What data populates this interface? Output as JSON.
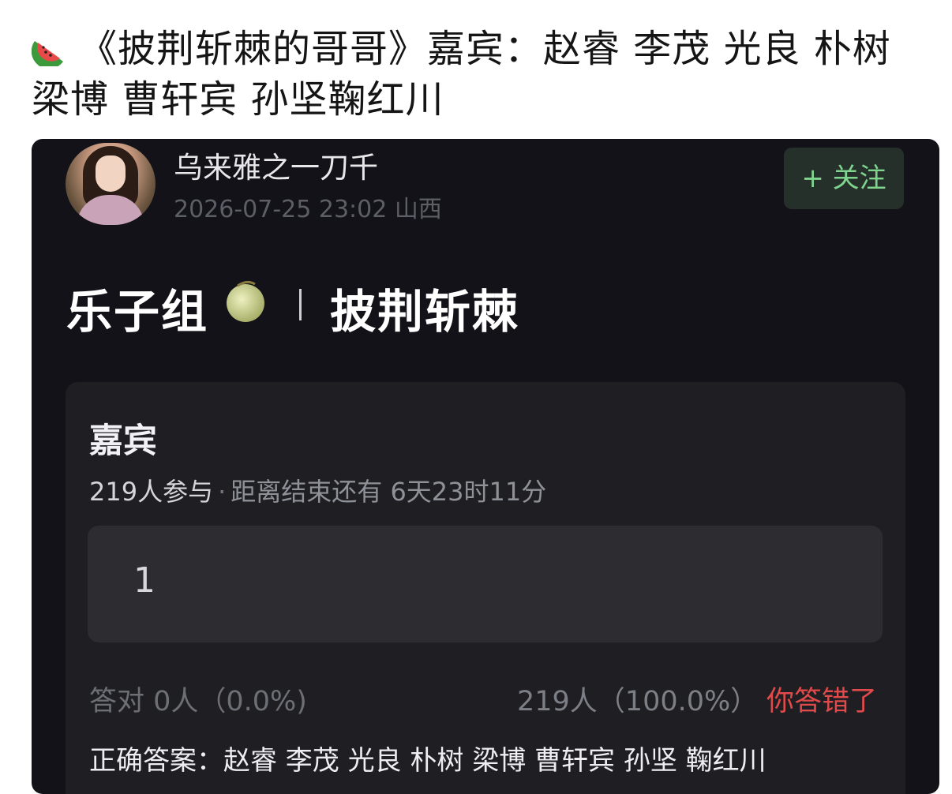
{
  "headline": {
    "emoji_icon": "watermelon-icon",
    "text": "《披荆斩棘的哥哥》嘉宾：赵睿 李茂 光良 朴树 梁博 曹轩宾 孙坚鞠红川"
  },
  "post": {
    "username": "乌来雅之一刀千",
    "timestamp": "2026-07-25 23:02",
    "location": "山西",
    "follow_label": "+ 关注"
  },
  "topic": {
    "group": "乐子组",
    "group_icon": "melon-icon",
    "name": "披荆斩棘"
  },
  "poll": {
    "title": "嘉宾",
    "participants": "219人参与",
    "separator": "·",
    "remaining": "距离结束还有 6天23时11分",
    "option_label": "1",
    "correct_stat": "答对  0人（0.0%)",
    "wrong_stat": "219人（100.0%）",
    "wrong_badge": "你答错了",
    "answer": "正确答案：赵睿 李茂 光良 朴树 梁博 曹轩宾 孙坚 鞠红川"
  },
  "colors": {
    "card_bg": "#121218",
    "poll_bg": "#1f1f23",
    "follow_text": "#7fd48e",
    "wrong": "#e04a4a"
  }
}
